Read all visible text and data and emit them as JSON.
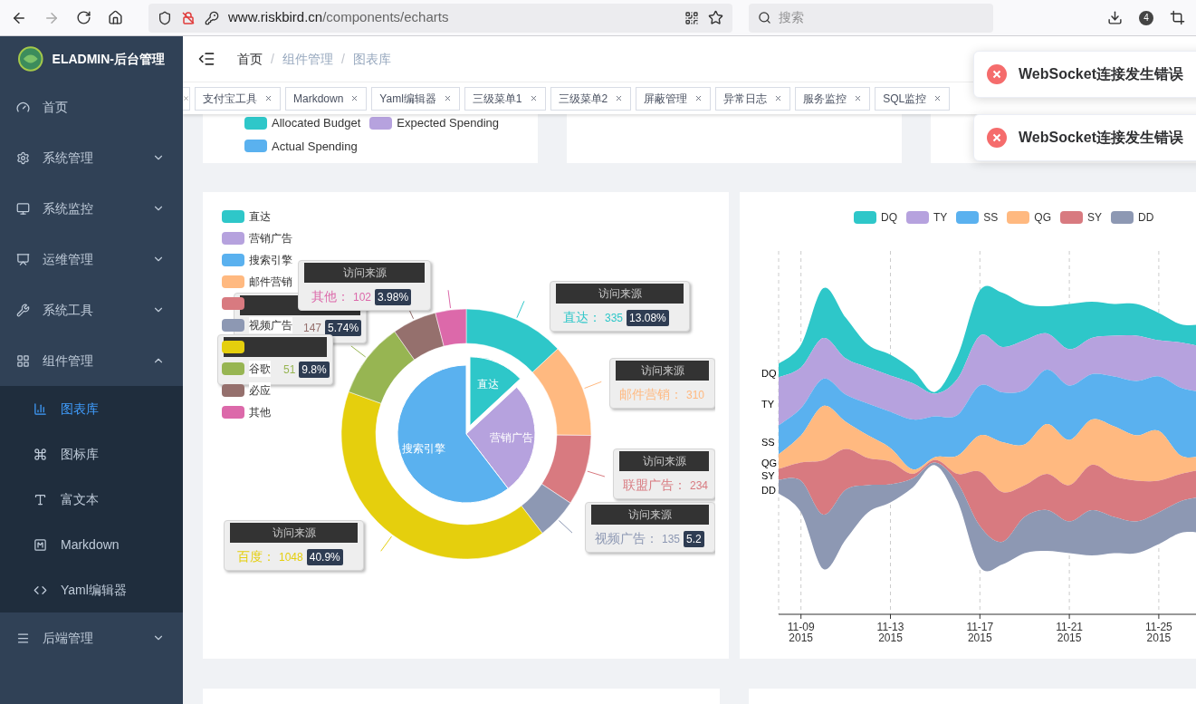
{
  "browser": {
    "forward_disabled": true,
    "url_host": "www.riskbird.cn",
    "url_path": "/components/echarts",
    "search_placeholder": "搜索",
    "badge": "4"
  },
  "sidebar": {
    "title": "ELADMIN-后台管理",
    "items": [
      {
        "label": "首页"
      },
      {
        "label": "系统管理",
        "expanded": false
      },
      {
        "label": "系统监控",
        "expanded": false
      },
      {
        "label": "运维管理",
        "expanded": false
      },
      {
        "label": "系统工具",
        "expanded": false
      },
      {
        "label": "组件管理",
        "expanded": true,
        "children": [
          {
            "label": "图表库",
            "selected": true
          },
          {
            "label": "图标库",
            "selected": false
          },
          {
            "label": "富文本",
            "selected": false
          },
          {
            "label": "Markdown",
            "selected": false
          },
          {
            "label": "Yaml编辑器",
            "selected": false
          }
        ]
      },
      {
        "label": "后端管理",
        "expanded": false
      }
    ]
  },
  "breadcrumb": {
    "separator": "/",
    "items": [
      {
        "label": "首页",
        "link": false
      },
      {
        "label": "组件管理",
        "link": true
      },
      {
        "label": "图表库",
        "link": true
      }
    ]
  },
  "tags": [
    "支付宝工具",
    "Markdown",
    "Yaml编辑器",
    "三级菜单1",
    "三级菜单2",
    "屏蔽管理",
    "异常日志",
    "服务监控",
    "SQL监控"
  ],
  "top_legend": [
    {
      "label": "Allocated Budget",
      "color": "#2ec7c9"
    },
    {
      "label": "Expected Spending",
      "color": "#b6a2de"
    },
    {
      "label": "Actual Spending",
      "color": "#5ab1ef"
    }
  ],
  "pie_card": {
    "legend": [
      {
        "label": "直达",
        "color": "#2ec7c9"
      },
      {
        "label": "营销广告",
        "color": "#b6a2de"
      },
      {
        "label": "搜索引擎",
        "color": "#5ab1ef"
      },
      {
        "label": "邮件营销",
        "color": "#ffb980"
      },
      {
        "color": "#d87a80"
      },
      {
        "label": "视频广告",
        "color": "#8d98b3"
      },
      {
        "color": "#e5cf0d"
      },
      {
        "label": "谷歌",
        "color": "#97b552"
      },
      {
        "label": "必应",
        "color": "#95706d"
      },
      {
        "label": "其他",
        "color": "#dc69aa"
      }
    ],
    "inner": {
      "chart_data": {
        "type": "pie",
        "categories": [
          "直达",
          "营销广告",
          "搜索引擎"
        ],
        "values": [
          13.08,
          26.5,
          60.42
        ]
      },
      "pulled_out": [
        true,
        false,
        false
      ]
    },
    "outer": {
      "chart_data": {
        "type": "donut",
        "values": [
          13.08,
          12.1,
          9.13,
          5.27,
          40.9,
          9.8,
          5.74,
          3.98
        ]
      }
    },
    "callouts": [
      {
        "value": "147",
        "percent": "5.74%",
        "color": "#95706d"
      },
      {
        "value": "51",
        "percent": "9.8%",
        "color": "#97b552"
      },
      {
        "title": "访问来源",
        "name": "其他：",
        "value": "102",
        "percent": "3.98%",
        "color": "#dc69aa"
      },
      {
        "title": "访问来源",
        "name": "直达：",
        "value": "335",
        "percent": "13.08%",
        "color": "#2ec7c9"
      },
      {
        "title": "访问来源",
        "name": "邮件营销：",
        "value": "310",
        "color": "#ffb980"
      },
      {
        "title": "访问来源",
        "name": "联盟广告：",
        "value": "234",
        "color": "#d87a80"
      },
      {
        "title": "访问来源",
        "name": "视频广告：",
        "value": "135",
        "percent": "5.2",
        "color": "#8d98b3"
      },
      {
        "title": "访问来源",
        "name": "百度：",
        "value": "1048",
        "percent": "40.9%",
        "color": "#e5cf0d"
      }
    ]
  },
  "stream_card": {
    "legend": [
      {
        "label": "DQ",
        "color": "#2ec7c9"
      },
      {
        "label": "TY",
        "color": "#b6a2de"
      },
      {
        "label": "SS",
        "color": "#5ab1ef"
      },
      {
        "label": "QG",
        "color": "#ffb980"
      },
      {
        "label": "SY",
        "color": "#d87a80"
      },
      {
        "label": "DD",
        "color": "#8d98b3"
      }
    ],
    "side_labels": [
      "DQ",
      "TY",
      "SS",
      "QG",
      "SY",
      "DD"
    ],
    "x_ticks": [
      {
        "date": "11-09",
        "year": "2015"
      },
      {
        "date": "11-13",
        "year": "2015"
      },
      {
        "date": "11-17",
        "year": "2015"
      },
      {
        "date": "11-21",
        "year": "2015"
      },
      {
        "date": "11-25",
        "year": "2015"
      }
    ]
  },
  "notifications": [
    {
      "text": "WebSocket连接发生错误"
    },
    {
      "text": "WebSocket连接发生错误"
    }
  ]
}
